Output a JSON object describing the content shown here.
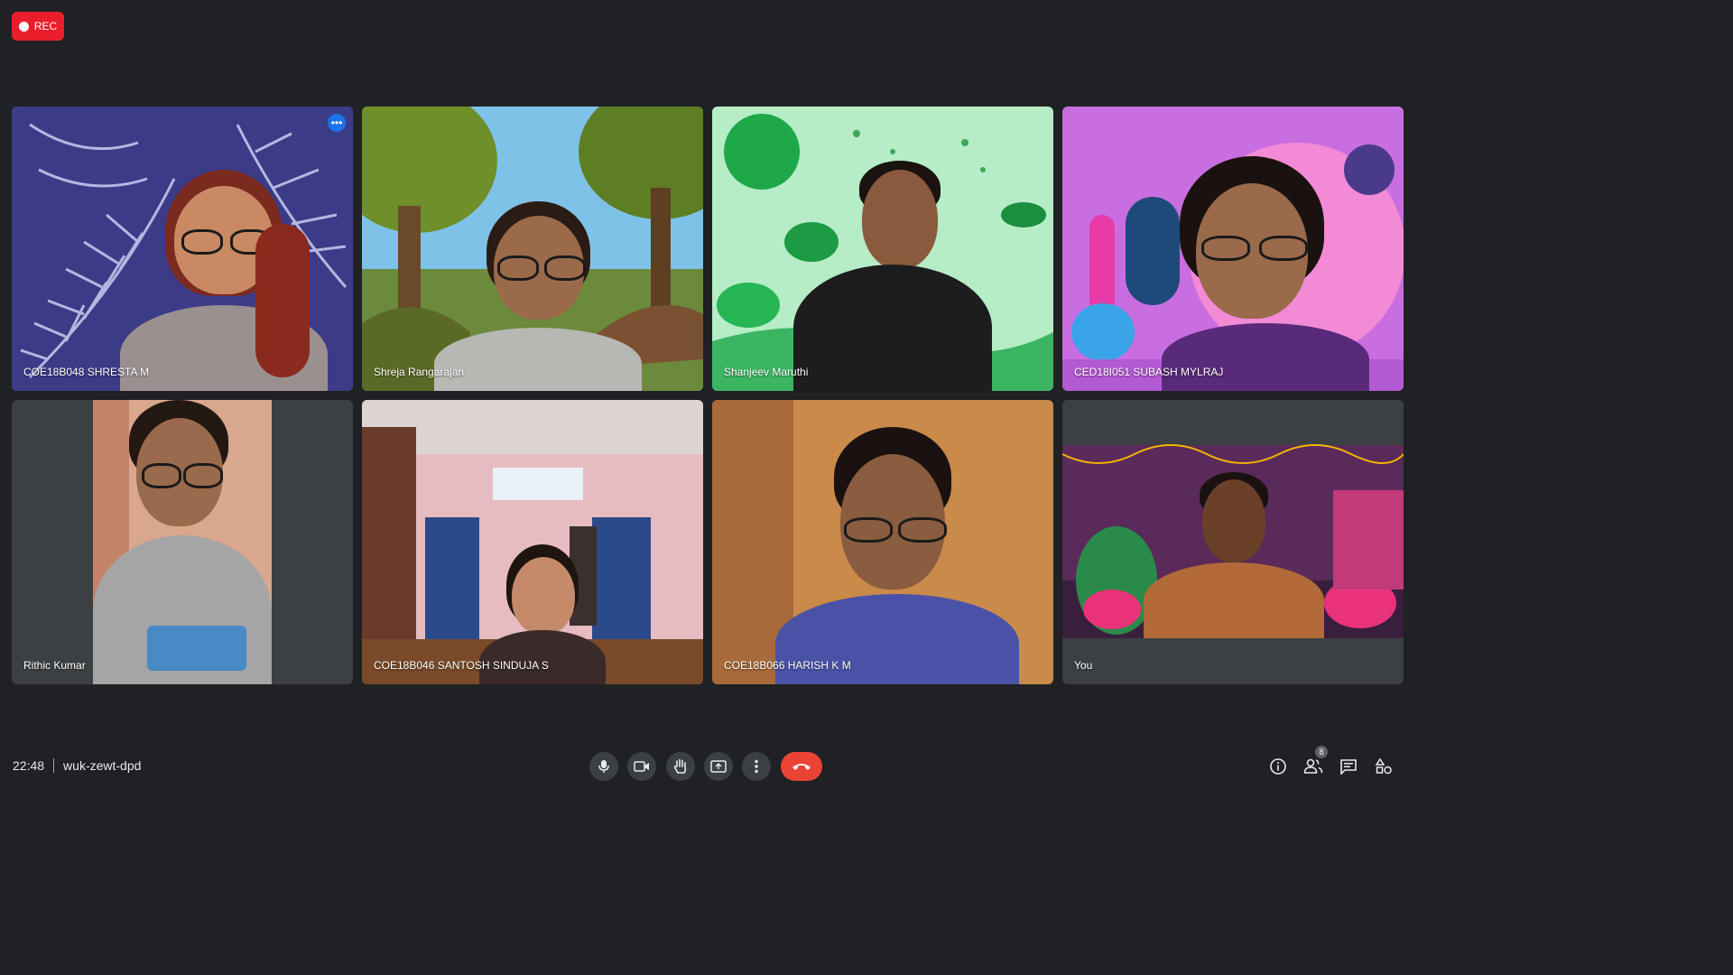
{
  "recording": {
    "label": "REC"
  },
  "participants": [
    {
      "name": "COE18B048 SHRESTA M"
    },
    {
      "name": "Shreja Rangarajan"
    },
    {
      "name": "Shanjeev Maruthi"
    },
    {
      "name": "CED18I051 SUBASH MYLRAJ"
    },
    {
      "name": "Rithic Kumar"
    },
    {
      "name": "COE18B046 SANTOSH SINDUJA S"
    },
    {
      "name": "COE18B066 HARISH K M"
    },
    {
      "name": "You"
    }
  ],
  "meeting": {
    "time": "22:48",
    "code": "wuk-zewt-dpd"
  },
  "participant_count": "8",
  "colors": {
    "background": "#202124",
    "end_call": "#ea4335",
    "rec": "#ea1e2b",
    "active_speaker": "#8ab4f8"
  },
  "icons": [
    "mic-icon",
    "camera-icon",
    "raise-hand-icon",
    "present-icon",
    "more-options-icon",
    "end-call-icon",
    "info-icon",
    "people-icon",
    "chat-icon",
    "activities-icon"
  ]
}
